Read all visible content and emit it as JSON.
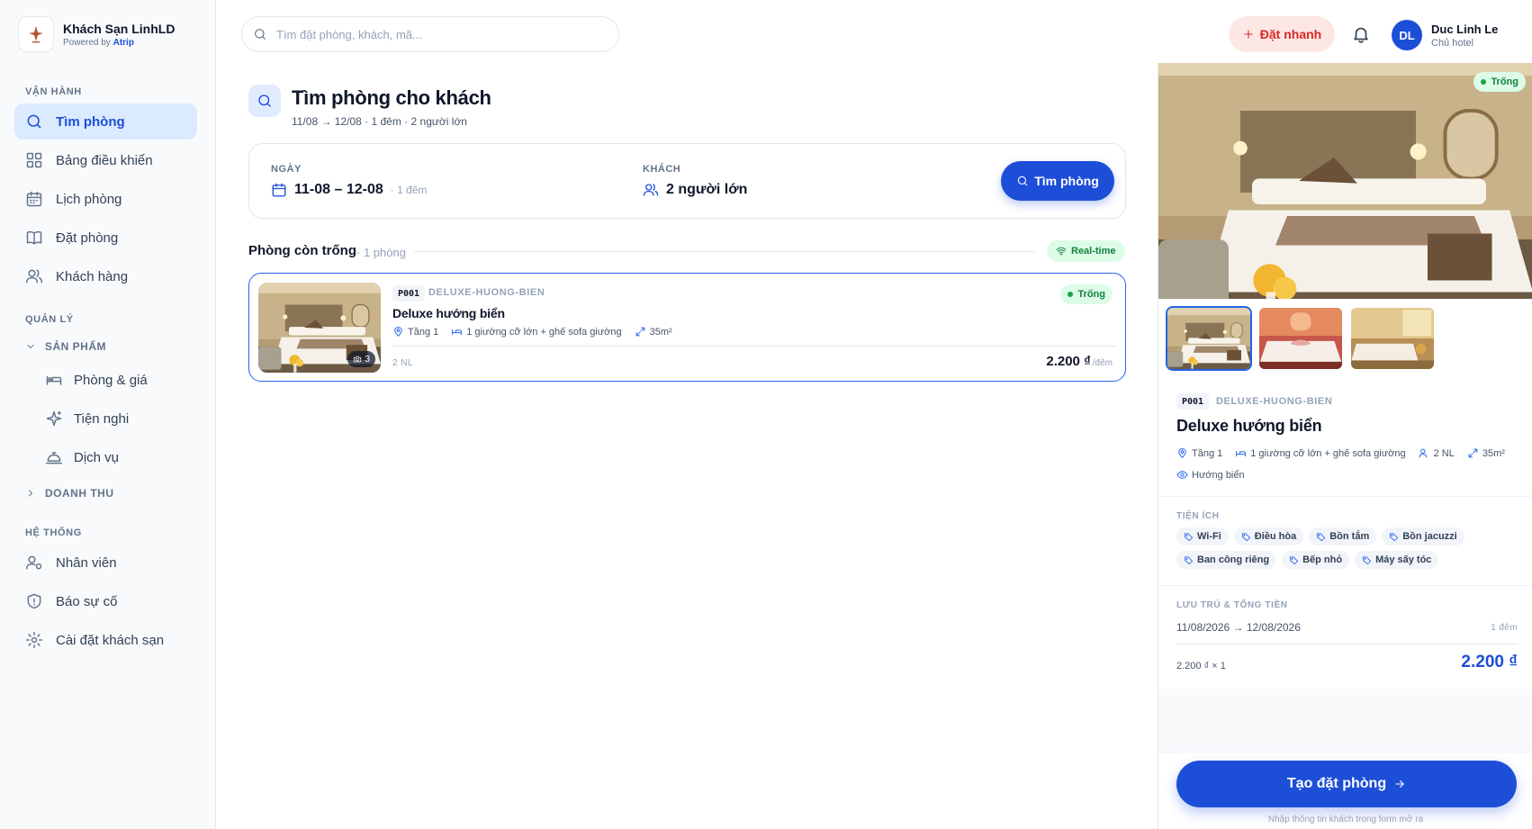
{
  "brand": {
    "name": "Khách Sạn LinhLD",
    "powered_prefix": "Powered by",
    "powered_name": "Atrip"
  },
  "sidebar": {
    "sections": {
      "operations": "VẬN HÀNH",
      "management": "QUẢN LÝ",
      "system": "HỆ THỐNG"
    },
    "items": [
      {
        "label": "Tìm phòng",
        "icon": "search-icon"
      },
      {
        "label": "Bảng điều khiển",
        "icon": "grid-icon"
      },
      {
        "label": "Lịch phòng",
        "icon": "calendar-icon"
      },
      {
        "label": "Đặt phòng",
        "icon": "book-icon"
      },
      {
        "label": "Khách hàng",
        "icon": "users-icon"
      }
    ],
    "group_products": "SẢN PHẨM",
    "sub_items": [
      {
        "label": "Phòng & giá",
        "icon": "bed-icon"
      },
      {
        "label": "Tiện nghi",
        "icon": "sparkle-icon"
      },
      {
        "label": "Dịch vụ",
        "icon": "bell-service-icon"
      }
    ],
    "group_revenue": "DOANH THU",
    "system_items": [
      {
        "label": "Nhân viên",
        "icon": "staff-icon"
      },
      {
        "label": "Báo sự cố",
        "icon": "shield-icon"
      },
      {
        "label": "Cài đặt khách sạn",
        "icon": "gear-icon"
      }
    ]
  },
  "header": {
    "search_placeholder": "Tìm đặt phòng, khách, mã...",
    "quick_book": "Đặt nhanh",
    "user_initials": "DL",
    "user_name": "Duc Linh Le",
    "user_role": "Chủ hotel"
  },
  "main": {
    "title": "Tìm phòng cho khách",
    "subtitle": "11/08 → 12/08 · 1 đêm · 2 người lớn",
    "date_label": "NGÀY",
    "date_value": "11-08 – 12-08",
    "date_nights": "· 1 đêm",
    "guest_label": "KHÁCH",
    "guest_value": "2 người lớn",
    "search_button": "Tìm phòng",
    "available_title": "Phòng còn trống",
    "available_count": "· 1 phòng",
    "realtime": "Real-time",
    "room": {
      "code": "P001",
      "slug": "DELUXE-HUONG-BIEN",
      "name": "Deluxe hướng biển",
      "status": "Trống",
      "floor": "Tầng 1",
      "beds": "1 giường cỡ lớn + ghế sofa giường",
      "area": "35m²",
      "guests_short": "2 NL",
      "price": "2.200 ₫",
      "price_unit": "/đêm",
      "photo_count": "3"
    }
  },
  "panel": {
    "status": "Trống",
    "code": "P001",
    "slug": "DELUXE-HUONG-BIEN",
    "name": "Deluxe hướng biển",
    "floor": "Tầng 1",
    "beds": "1 giường cỡ lớn + ghế sofa giường",
    "guests": "2 NL",
    "area": "35m²",
    "view": "Hướng biển",
    "amenities_label": "TIỆN ÍCH",
    "amenities": [
      "Wi-Fi",
      "Điều hòa",
      "Bồn tắm",
      "Bồn jacuzzi",
      "Ban công riêng",
      "Bếp nhỏ",
      "Máy sấy tóc"
    ],
    "stay_label": "LƯU TRÚ & TỔNG TIỀN",
    "stay_range": "11/08/2026 → 12/08/2026",
    "stay_nights": "1 đêm",
    "formula": "2.200 ₫ × 1",
    "total": "2.200 ₫",
    "create_button": "Tạo đặt phòng",
    "note": "Nhập thông tin khách trong form mở ra"
  },
  "colors": {
    "primary": "#1d4ed8",
    "success": "#16a34a",
    "danger": "#dc2626"
  }
}
